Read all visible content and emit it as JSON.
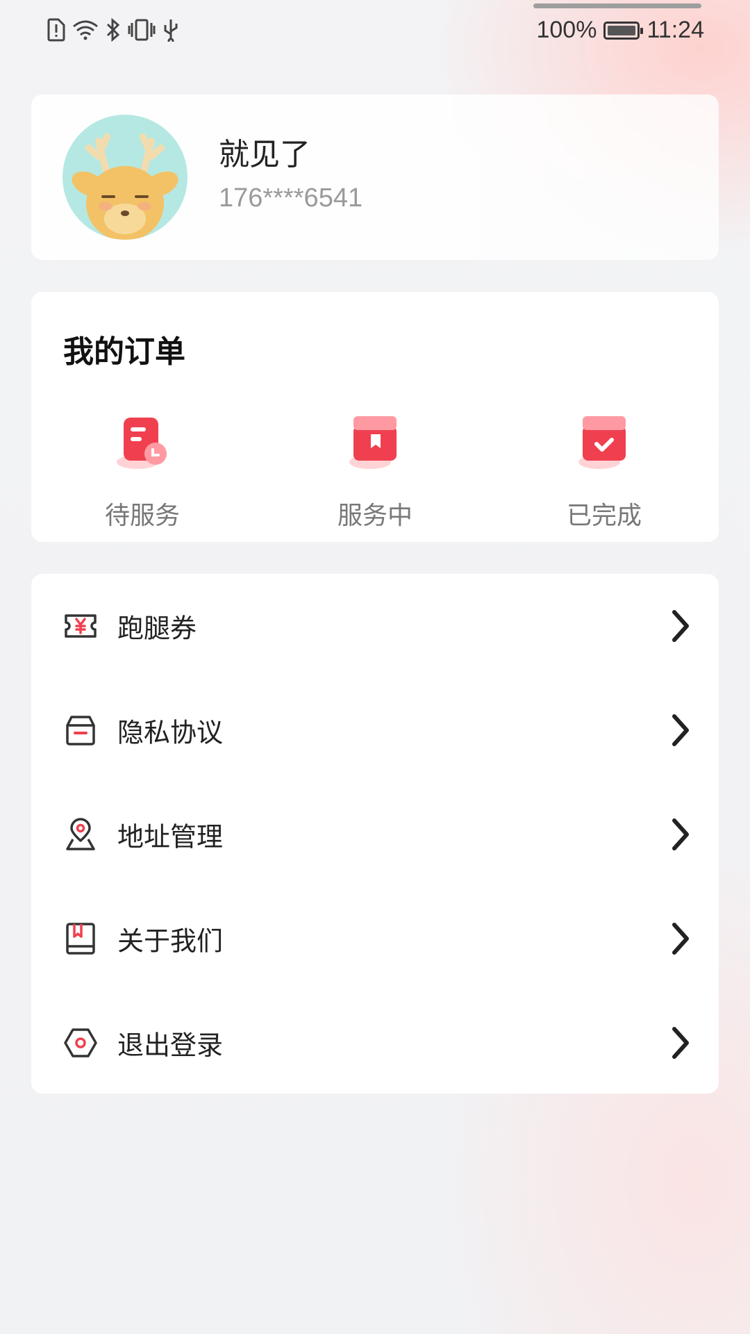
{
  "status_bar": {
    "battery_percent": "100%",
    "time": "11:24",
    "left_icons": [
      "sim-alert-icon",
      "wifi-icon",
      "bluetooth-icon",
      "vibrate-icon",
      "usb-icon"
    ]
  },
  "profile": {
    "name": "就见了",
    "phone": "176****6541"
  },
  "orders": {
    "title": "我的订单",
    "items": [
      {
        "label": "待服务",
        "icon": "pending-order-icon"
      },
      {
        "label": "服务中",
        "icon": "in-service-order-icon"
      },
      {
        "label": "已完成",
        "icon": "completed-order-icon"
      }
    ]
  },
  "menu": {
    "items": [
      {
        "label": "跑腿券",
        "icon": "coupon-icon"
      },
      {
        "label": "隐私协议",
        "icon": "privacy-box-icon"
      },
      {
        "label": "地址管理",
        "icon": "location-pin-icon"
      },
      {
        "label": "关于我们",
        "icon": "about-book-icon"
      },
      {
        "label": "退出登录",
        "icon": "logout-hexagon-icon"
      }
    ]
  },
  "colors": {
    "accent": "#f0404f",
    "accent_light": "#ff9aa3",
    "text_primary": "#222222",
    "text_secondary": "#9a9a9a"
  }
}
